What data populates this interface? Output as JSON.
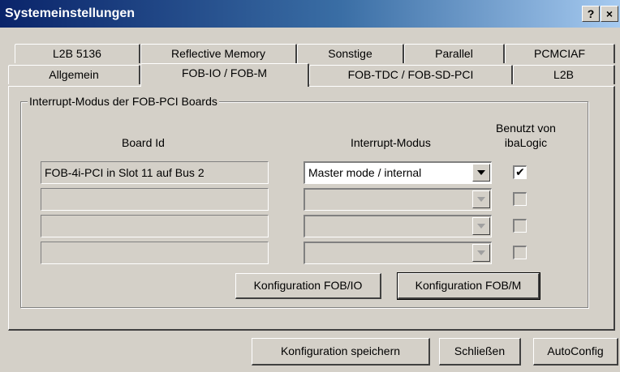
{
  "window": {
    "title": "Systemeinstellungen",
    "help_label": "?",
    "close_label": "×"
  },
  "tabs_row1": [
    {
      "label": "L2B 5136"
    },
    {
      "label": "Reflective Memory"
    },
    {
      "label": "Sonstige"
    },
    {
      "label": "Parallel"
    },
    {
      "label": "PCMCIAF"
    }
  ],
  "tabs_row2": [
    {
      "label": "Allgemein"
    },
    {
      "label": "FOB-IO / FOB-M",
      "active": true
    },
    {
      "label": "FOB-TDC / FOB-SD-PCI"
    },
    {
      "label": "L2B"
    }
  ],
  "group": {
    "title": "Interrupt-Modus der FOB-PCI Boards",
    "col_board_id": "Board Id",
    "col_interrupt_mode": "Interrupt-Modus",
    "col_used_line1": "Benutzt von",
    "col_used_line2": "ibaLogic",
    "rows": [
      {
        "board_id": "FOB-4i-PCI in Slot 11 auf Bus 2",
        "mode": "Master mode / internal",
        "used": true,
        "enabled": true
      },
      {
        "board_id": "",
        "mode": "",
        "used": false,
        "enabled": false
      },
      {
        "board_id": "",
        "mode": "",
        "used": false,
        "enabled": false
      },
      {
        "board_id": "",
        "mode": "",
        "used": false,
        "enabled": false
      }
    ],
    "btn_config_io": "Konfiguration FOB/IO",
    "btn_config_m": "Konfiguration FOB/M"
  },
  "footer": {
    "save": "Konfiguration speichern",
    "close": "Schließen",
    "autoconfig": "AutoConfig"
  },
  "colors": {
    "title_gradient_start": "#0a246a",
    "title_gradient_end": "#a6caf0",
    "face": "#d4d0c8"
  }
}
